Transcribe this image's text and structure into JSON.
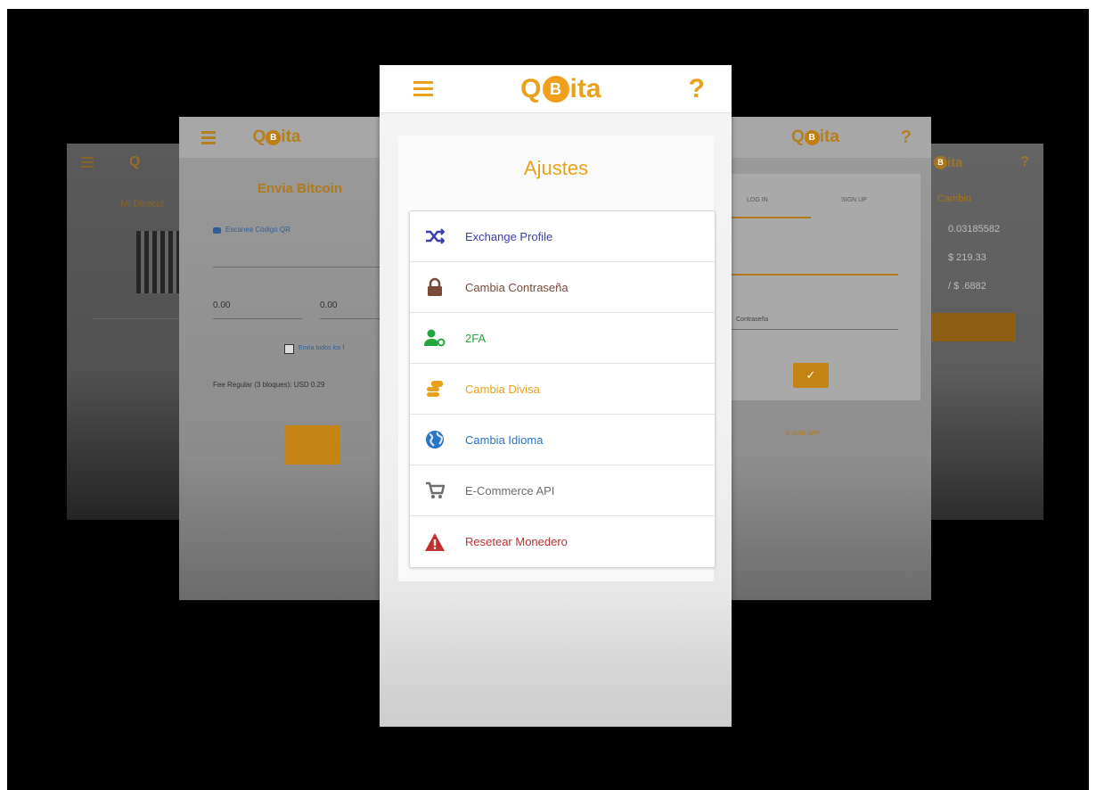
{
  "app": {
    "brand_prefix": "Q",
    "brand_coin": "B",
    "brand_suffix": "ita",
    "help": "?"
  },
  "settings": {
    "title": "Ajustes",
    "items": [
      {
        "label": "Exchange Profile",
        "icon": "shuffle-icon",
        "color": "#3b3fae"
      },
      {
        "label": "Cambia Contraseña",
        "icon": "lock-icon",
        "color": "#7a4a38"
      },
      {
        "label": "2FA",
        "icon": "user-key-icon",
        "color": "#23a43d"
      },
      {
        "label": "Cambia Divisa",
        "icon": "coins-icon",
        "color": "#e8a21a"
      },
      {
        "label": "Cambia Idioma",
        "icon": "globe-icon",
        "color": "#2a73c7"
      },
      {
        "label": "E-Commerce API",
        "icon": "cart-icon",
        "color": "#6d6d6d"
      },
      {
        "label": "Resetear Monedero",
        "icon": "warning-icon",
        "color": "#c03030"
      }
    ]
  },
  "left_screen": {
    "title": "Envia Bitcoin",
    "qr_label": "Escanea Código QR",
    "amount_1": "0.00",
    "amount_2": "0.00",
    "checkbox_label": "Envia todos los f",
    "fee": "Fee Regular (3 bloques): USD 0.29"
  },
  "farleft_screen": {
    "title": "Mi Direcci"
  },
  "right_screen": {
    "tab_login": "LOG IN",
    "tab_signup": "SIGN UP",
    "password_label": "Contraseña",
    "link": "E-MAIL APP"
  },
  "farright_screen": {
    "title": "Cambio",
    "value_1": "0.03185582",
    "value_2": "$ 219.33",
    "value_3": "/ $ .6882"
  },
  "colors": {
    "accent": "#e8a21a",
    "background": "#000000"
  }
}
